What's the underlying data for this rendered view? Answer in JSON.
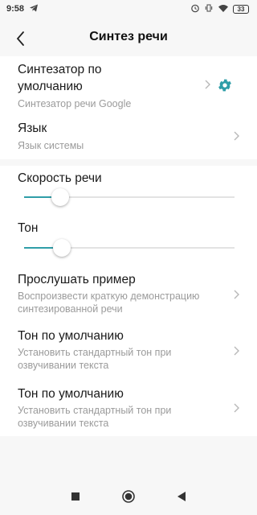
{
  "status_bar": {
    "time": "9:58",
    "battery": "33",
    "icons": [
      "telegram-icon",
      "alarm-icon",
      "vibrate-icon",
      "wifi-icon",
      "battery-icon"
    ]
  },
  "header": {
    "title": "Синтез речи",
    "back_icon": "back-arrow-icon"
  },
  "engine": {
    "title_line1": "Синтезатор по",
    "title_line2": "умолчанию",
    "subtitle": "Синтезатор речи Google"
  },
  "language": {
    "title": "Язык",
    "subtitle": "Язык системы"
  },
  "speech_rate": {
    "title": "Скорость речи",
    "level": 0.17
  },
  "pitch": {
    "title": "Тон",
    "level": 0.18
  },
  "listen_example": {
    "title": "Прослушать пример",
    "subtitle_line1": "Воспроизвести краткую демонстрацию",
    "subtitle_line2": "синтезированной речи"
  },
  "default_pitch_1": {
    "title": "Тон по умолчанию",
    "subtitle_line1": "Установить стандартный тон при",
    "subtitle_line2": "озвучивании текста"
  },
  "default_pitch_2": {
    "title": "Тон по умолчанию",
    "subtitle_line1": "Установить стандартный тон при",
    "subtitle_line2": "озвучивании текста"
  },
  "colors": {
    "accent": "#2f9ea8",
    "background": "#f7f7f7",
    "card": "#ffffff",
    "secondary_text": "#9b9b9b"
  },
  "nav_bar": {
    "icons": [
      "recents-square-icon",
      "home-circle-icon",
      "back-triangle-icon"
    ]
  }
}
